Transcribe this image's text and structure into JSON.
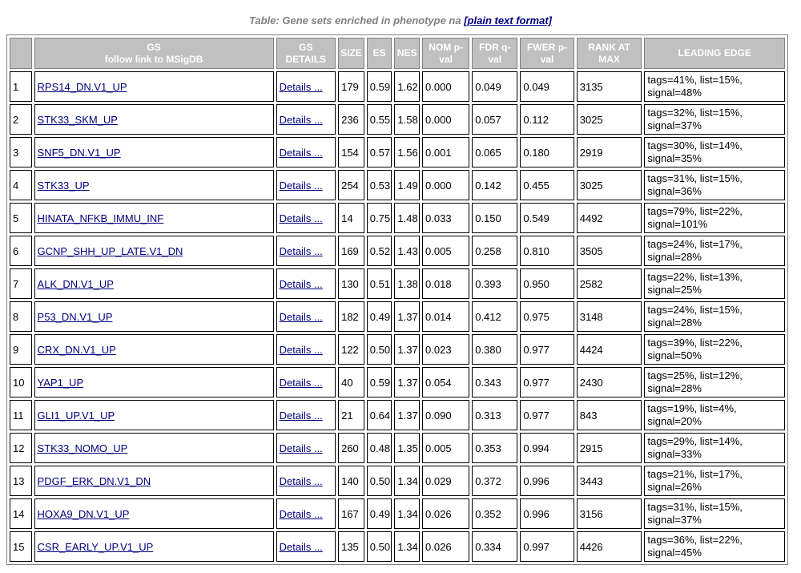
{
  "caption": {
    "prefix": "Table: Gene sets enriched in phenotype na ",
    "link": "[plain text format]"
  },
  "headers": {
    "gs_line1": "GS",
    "gs_line2": "follow link to MSigDB",
    "details_line1": "GS",
    "details_line2": "DETAILS",
    "size": "SIZE",
    "es": "ES",
    "nes": "NES",
    "nom_line1": "NOM p-",
    "nom_line2": "val",
    "fdr_line1": "FDR q-",
    "fdr_line2": "val",
    "fwer_line1": "FWER p-",
    "fwer_line2": "val",
    "rank_line1": "RANK AT",
    "rank_line2": "MAX",
    "leading_edge": "LEADING EDGE"
  },
  "details_label": "Details ...",
  "rows": [
    {
      "num": "1",
      "gs": "RPS14_DN.V1_UP",
      "size": "179",
      "es": "0.59",
      "nes": "1.62",
      "nom": "0.000",
      "fdr": "0.049",
      "fwer": "0.049",
      "rank": "3135",
      "le1": "tags=41%, list=15%,",
      "le2": "signal=48%"
    },
    {
      "num": "2",
      "gs": "STK33_SKM_UP",
      "size": "236",
      "es": "0.55",
      "nes": "1.58",
      "nom": "0.000",
      "fdr": "0.057",
      "fwer": "0.112",
      "rank": "3025",
      "le1": "tags=32%, list=15%,",
      "le2": "signal=37%"
    },
    {
      "num": "3",
      "gs": "SNF5_DN.V1_UP",
      "size": "154",
      "es": "0.57",
      "nes": "1.56",
      "nom": "0.001",
      "fdr": "0.065",
      "fwer": "0.180",
      "rank": "2919",
      "le1": "tags=30%, list=14%,",
      "le2": "signal=35%"
    },
    {
      "num": "4",
      "gs": "STK33_UP",
      "size": "254",
      "es": "0.53",
      "nes": "1.49",
      "nom": "0.000",
      "fdr": "0.142",
      "fwer": "0.455",
      "rank": "3025",
      "le1": "tags=31%, list=15%,",
      "le2": "signal=36%"
    },
    {
      "num": "5",
      "gs": "HINATA_NFKB_IMMU_INF",
      "size": "14",
      "es": "0.75",
      "nes": "1.48",
      "nom": "0.033",
      "fdr": "0.150",
      "fwer": "0.549",
      "rank": "4492",
      "le1": "tags=79%, list=22%,",
      "le2": "signal=101%"
    },
    {
      "num": "6",
      "gs": "GCNP_SHH_UP_LATE.V1_DN",
      "size": "169",
      "es": "0.52",
      "nes": "1.43",
      "nom": "0.005",
      "fdr": "0.258",
      "fwer": "0.810",
      "rank": "3505",
      "le1": "tags=24%, list=17%,",
      "le2": "signal=28%"
    },
    {
      "num": "7",
      "gs": "ALK_DN.V1_UP",
      "size": "130",
      "es": "0.51",
      "nes": "1.38",
      "nom": "0.018",
      "fdr": "0.393",
      "fwer": "0.950",
      "rank": "2582",
      "le1": "tags=22%, list=13%,",
      "le2": "signal=25%"
    },
    {
      "num": "8",
      "gs": "P53_DN.V1_UP",
      "size": "182",
      "es": "0.49",
      "nes": "1.37",
      "nom": "0.014",
      "fdr": "0.412",
      "fwer": "0.975",
      "rank": "3148",
      "le1": "tags=24%, list=15%,",
      "le2": "signal=28%"
    },
    {
      "num": "9",
      "gs": "CRX_DN.V1_UP",
      "size": "122",
      "es": "0.50",
      "nes": "1.37",
      "nom": "0.023",
      "fdr": "0.380",
      "fwer": "0.977",
      "rank": "4424",
      "le1": "tags=39%, list=22%,",
      "le2": "signal=50%"
    },
    {
      "num": "10",
      "gs": "YAP1_UP",
      "size": "40",
      "es": "0.59",
      "nes": "1.37",
      "nom": "0.054",
      "fdr": "0.343",
      "fwer": "0.977",
      "rank": "2430",
      "le1": "tags=25%, list=12%,",
      "le2": "signal=28%"
    },
    {
      "num": "11",
      "gs": "GLI1_UP.V1_UP",
      "size": "21",
      "es": "0.64",
      "nes": "1.37",
      "nom": "0.090",
      "fdr": "0.313",
      "fwer": "0.977",
      "rank": "843",
      "le1": "tags=19%, list=4%,",
      "le2": "signal=20%"
    },
    {
      "num": "12",
      "gs": "STK33_NOMO_UP",
      "size": "260",
      "es": "0.48",
      "nes": "1.35",
      "nom": "0.005",
      "fdr": "0.353",
      "fwer": "0.994",
      "rank": "2915",
      "le1": "tags=29%, list=14%,",
      "le2": "signal=33%"
    },
    {
      "num": "13",
      "gs": "PDGF_ERK_DN.V1_DN",
      "size": "140",
      "es": "0.50",
      "nes": "1.34",
      "nom": "0.029",
      "fdr": "0.372",
      "fwer": "0.996",
      "rank": "3443",
      "le1": "tags=21%, list=17%,",
      "le2": "signal=26%"
    },
    {
      "num": "14",
      "gs": "HOXA9_DN.V1_UP",
      "size": "167",
      "es": "0.49",
      "nes": "1.34",
      "nom": "0.026",
      "fdr": "0.352",
      "fwer": "0.996",
      "rank": "3156",
      "le1": "tags=31%, list=15%,",
      "le2": "signal=37%"
    },
    {
      "num": "15",
      "gs": "CSR_EARLY_UP.V1_UP",
      "size": "135",
      "es": "0.50",
      "nes": "1.34",
      "nom": "0.026",
      "fdr": "0.334",
      "fwer": "0.997",
      "rank": "4426",
      "le1": "tags=36%, list=22%,",
      "le2": "signal=45%"
    }
  ]
}
